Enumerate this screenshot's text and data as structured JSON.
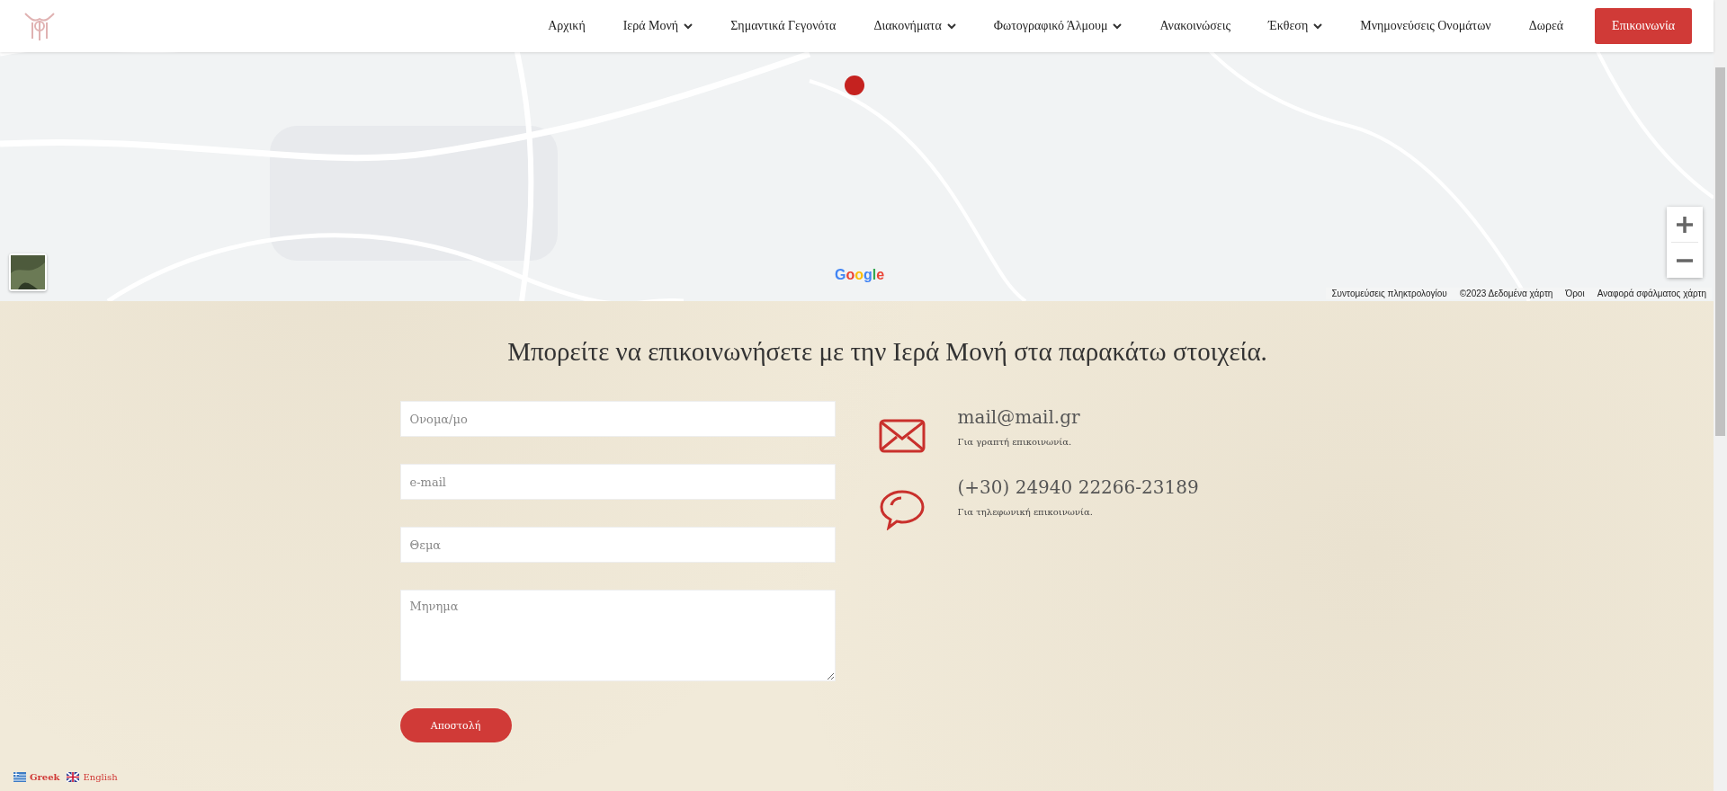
{
  "nav": {
    "items": [
      {
        "label": "Αρχική",
        "has_menu": false,
        "kind": "link"
      },
      {
        "label": "Ιερά Μονή",
        "has_menu": true,
        "kind": "link"
      },
      {
        "label": "Σημαντικά Γεγονότα",
        "has_menu": false,
        "kind": "link"
      },
      {
        "label": "Διακονήματα",
        "has_menu": true,
        "kind": "link"
      },
      {
        "label": "Φωτογραφικό Άλμουμ",
        "has_menu": true,
        "kind": "link"
      },
      {
        "label": "Ανακοινώσεις",
        "has_menu": false,
        "kind": "link"
      },
      {
        "label": "Έκθεση",
        "has_menu": true,
        "kind": "link"
      },
      {
        "label": "Μνημονεύσεις Ονομάτων",
        "has_menu": false,
        "kind": "link"
      },
      {
        "label": "Δωρεά",
        "has_menu": false,
        "kind": "link"
      },
      {
        "label": "Επικοινωνία",
        "has_menu": false,
        "kind": "cta"
      }
    ]
  },
  "map": {
    "logo": "Google",
    "attribution": [
      "Συντομεύσεις πληκτρολογίου",
      "©2023 Δεδομένα χάρτη",
      "Όροι",
      "Αναφορά σφάλματος χάρτη"
    ]
  },
  "contact": {
    "heading": "Μπορείτε να επικοινωνήσετε με την Ιερά Μονή στα παρακάτω στοιχεία.",
    "form": {
      "fields": [
        {
          "placeholder": "Ονομα/μο",
          "kind": "input"
        },
        {
          "placeholder": "e-mail",
          "kind": "input"
        },
        {
          "placeholder": "Θεμα",
          "kind": "input"
        },
        {
          "placeholder": "Μηνημα",
          "kind": "textarea"
        }
      ],
      "submit": "Αποστολή"
    },
    "details": [
      {
        "kind": "mail",
        "value": "mail@mail.gr",
        "note": "Για γραπτή επικοινωνία."
      },
      {
        "kind": "phone",
        "value": "(+30) 24940 22266-23189",
        "note": "Για τηλεφωνική επικοινωνία."
      }
    ]
  },
  "languages": [
    {
      "label": "Greek",
      "kind": "gr",
      "selected": true
    },
    {
      "label": "English",
      "kind": "en",
      "selected": false
    }
  ]
}
